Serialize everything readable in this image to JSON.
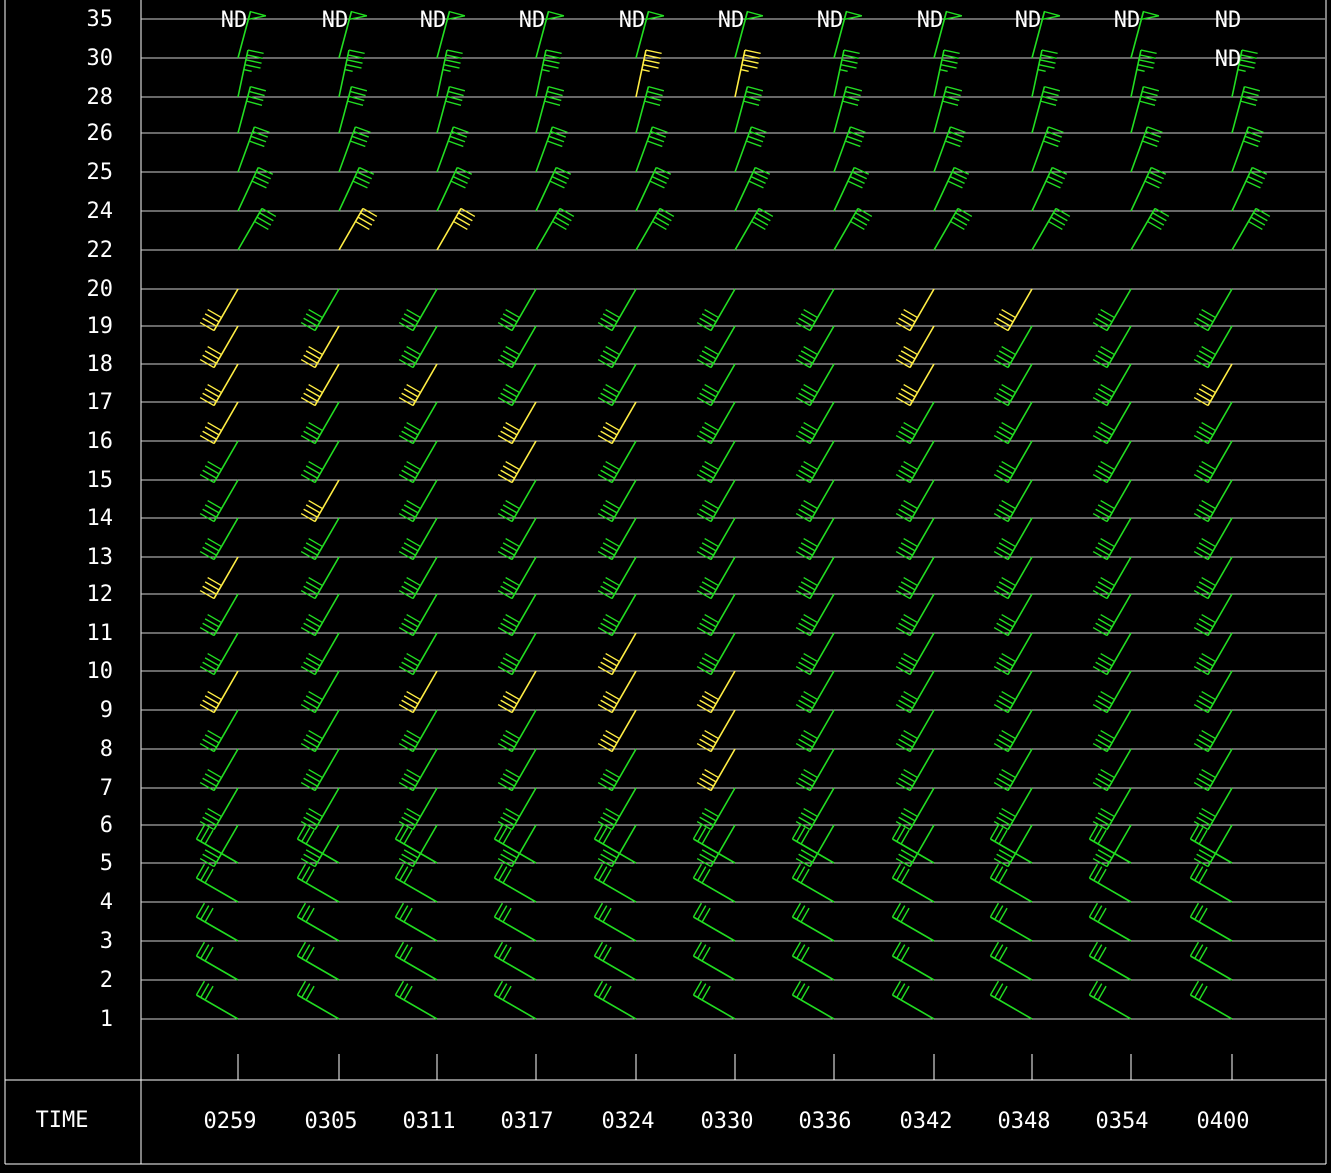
{
  "time_label": "TIME",
  "nd_label": "ND",
  "colors": {
    "background": "#000000",
    "grid": "#ffffff",
    "text": "#ffffff",
    "barb_normal": "#22dd22",
    "barb_highlight": "#ffee44"
  },
  "chart_data": {
    "type": "wind-barb profile",
    "title": "",
    "xlabel": "TIME",
    "ylabel": "",
    "y_levels": [
      "35",
      "30",
      "28",
      "26",
      "25",
      "24",
      "22",
      "20",
      "19",
      "18",
      "17",
      "16",
      "15",
      "14",
      "13",
      "12",
      "11",
      "10",
      "9",
      "8",
      "7",
      "6",
      "5",
      "4",
      "3",
      "2",
      "1"
    ],
    "times": [
      "0259",
      "0305",
      "0311",
      "0317",
      "0324",
      "0330",
      "0336",
      "0342",
      "0348",
      "0354",
      "0400"
    ],
    "no_data": [
      {
        "time": "0259",
        "level": "35"
      },
      {
        "time": "0305",
        "level": "35"
      },
      {
        "time": "0311",
        "level": "35"
      },
      {
        "time": "0317",
        "level": "35"
      },
      {
        "time": "0324",
        "level": "35"
      },
      {
        "time": "0330",
        "level": "35"
      },
      {
        "time": "0336",
        "level": "35"
      },
      {
        "time": "0342",
        "level": "35"
      },
      {
        "time": "0348",
        "level": "35"
      },
      {
        "time": "0354",
        "level": "35"
      },
      {
        "time": "0400",
        "level": "35"
      },
      {
        "time": "0400",
        "level": "30"
      }
    ],
    "barbs_upper_default": {
      "from_deg": 210,
      "speed_kt": 40
    },
    "barbs_upper_overrides": {
      "30": {
        "from_deg": 15,
        "speed_kt": 50
      },
      "28": {
        "from_deg": 12,
        "speed_kt": 45
      },
      "26": {
        "from_deg": 15,
        "speed_kt": 40
      },
      "25": {
        "from_deg": 20,
        "speed_kt": 40
      },
      "24": {
        "from_deg": 25,
        "speed_kt": 40
      },
      "22": {
        "from_deg": 30,
        "speed_kt": 40
      }
    },
    "highlighted_barbs": [
      {
        "time": "0259",
        "level": "20"
      },
      {
        "time": "0259",
        "level": "19"
      },
      {
        "time": "0259",
        "level": "18"
      },
      {
        "time": "0259",
        "level": "17"
      },
      {
        "time": "0259",
        "level": "13"
      },
      {
        "time": "0259",
        "level": "10"
      },
      {
        "time": "0305",
        "level": "22"
      },
      {
        "time": "0305",
        "level": "19"
      },
      {
        "time": "0305",
        "level": "18"
      },
      {
        "time": "0305",
        "level": "15"
      },
      {
        "time": "0311",
        "level": "22"
      },
      {
        "time": "0311",
        "level": "18"
      },
      {
        "time": "0311",
        "level": "10"
      },
      {
        "time": "0317",
        "level": "17"
      },
      {
        "time": "0317",
        "level": "16"
      },
      {
        "time": "0317",
        "level": "10"
      },
      {
        "time": "0324",
        "level": "28"
      },
      {
        "time": "0324",
        "level": "17"
      },
      {
        "time": "0324",
        "level": "11"
      },
      {
        "time": "0324",
        "level": "10"
      },
      {
        "time": "0324",
        "level": "9"
      },
      {
        "time": "0330",
        "level": "28"
      },
      {
        "time": "0330",
        "level": "10"
      },
      {
        "time": "0330",
        "level": "9"
      },
      {
        "time": "0330",
        "level": "8"
      },
      {
        "time": "0342",
        "level": "20"
      },
      {
        "time": "0342",
        "level": "19"
      },
      {
        "time": "0342",
        "level": "18"
      },
      {
        "time": "0348",
        "level": "20"
      },
      {
        "time": "0400",
        "level": "18"
      }
    ],
    "barbs_lower": {
      "from_deg": 300,
      "speed_kt": 30
    }
  }
}
